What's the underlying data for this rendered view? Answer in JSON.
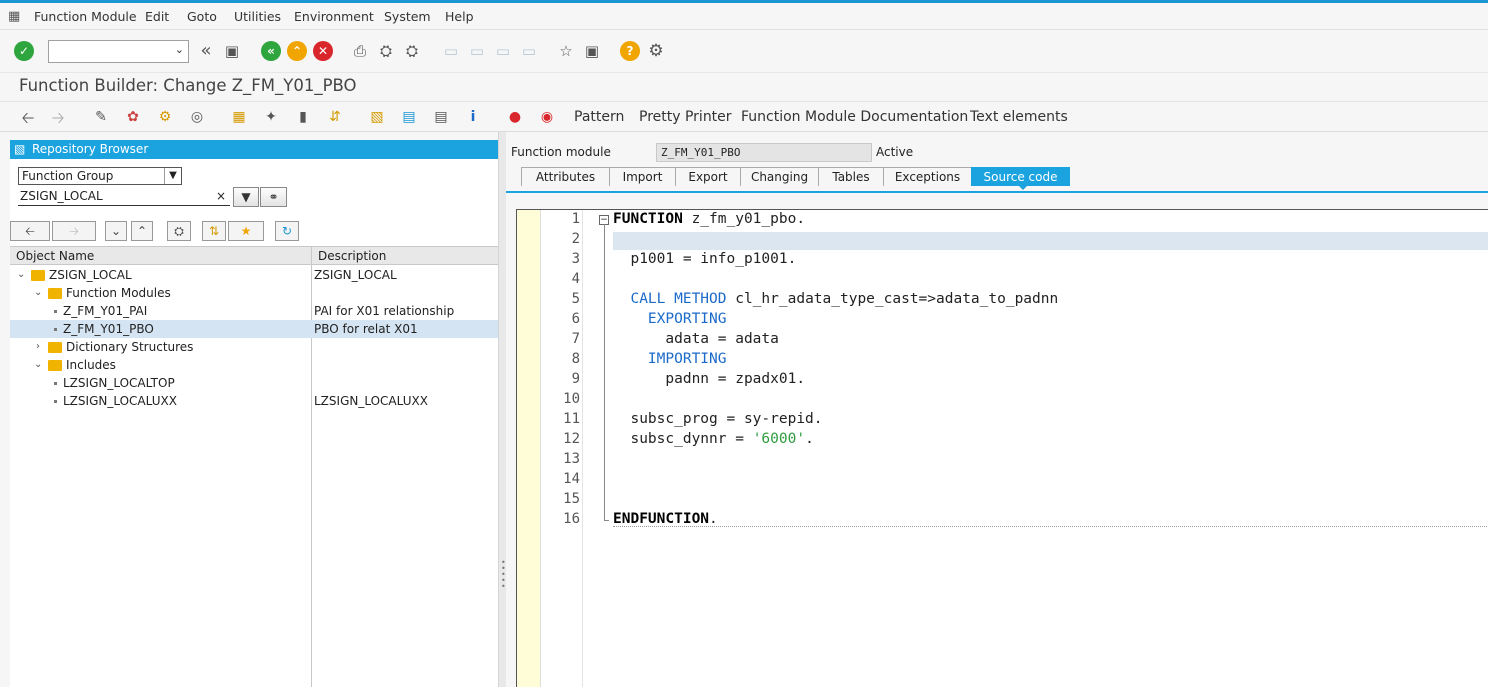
{
  "menubar": {
    "items": [
      "Function Module",
      "Edit",
      "Goto",
      "Utilities",
      "Environment",
      "System",
      "Help"
    ]
  },
  "title": "Function Builder: Change Z_FM_Y01_PBO",
  "app_toolbar": {
    "pattern": "Pattern",
    "pretty_printer": "Pretty Printer",
    "fm_documentation": "Function Module Documentation",
    "text_elements": "Text elements"
  },
  "repository": {
    "header": "Repository Browser",
    "object_type": "Function Group",
    "object_name": "ZSIGN_LOCAL",
    "columns": [
      "Object Name",
      "Description"
    ],
    "rows": [
      {
        "name": "ZSIGN_LOCAL",
        "desc": "ZSIGN_LOCAL"
      },
      {
        "name": "Function Modules",
        "desc": ""
      },
      {
        "name": "Z_FM_Y01_PAI",
        "desc": "PAI for X01 relationship"
      },
      {
        "name": "Z_FM_Y01_PBO",
        "desc": "PBO for relat X01"
      },
      {
        "name": "Dictionary Structures",
        "desc": ""
      },
      {
        "name": "Includes",
        "desc": ""
      },
      {
        "name": "LZSIGN_LOCALTOP",
        "desc": ""
      },
      {
        "name": "LZSIGN_LOCALUXX",
        "desc": "LZSIGN_LOCALUXX"
      }
    ]
  },
  "function_module": {
    "label": "Function module",
    "value": "Z_FM_Y01_PBO",
    "status": "Active"
  },
  "tabs": [
    "Attributes",
    "Import",
    "Export",
    "Changing",
    "Tables",
    "Exceptions",
    "Source code"
  ],
  "active_tab": "Source code",
  "editor": {
    "line_numbers": [
      "1",
      "2",
      "3",
      "4",
      "5",
      "6",
      "7",
      "8",
      "9",
      "10",
      "11",
      "12",
      "13",
      "14",
      "15",
      "16"
    ],
    "code": {
      "l1_kw": "FUNCTION",
      "l1_rest": " z_fm_y01_pbo.",
      "l3": "  p1001 = info_p1001.",
      "l5_kw": "CALL METHOD",
      "l5_rest": " cl_hr_adata_type_cast=>adata_to_padnn",
      "l6_kw": "EXPORTING",
      "l7": "      adata = adata",
      "l8_kw": "IMPORTING",
      "l9": "      padnn = zpadx01.",
      "l11": "  subsc_prog = sy-repid.",
      "l12_pre": "  subsc_dynnr = ",
      "l12_str": "'6000'",
      "l12_post": ".",
      "l16_kw": "ENDFUNCTION",
      "l16_post": "."
    }
  },
  "colors": {
    "accent": "#1ba3e0",
    "keyword": "#1b6ac9",
    "string": "#2f9b3f",
    "selected_row": "#d4e4f2"
  }
}
